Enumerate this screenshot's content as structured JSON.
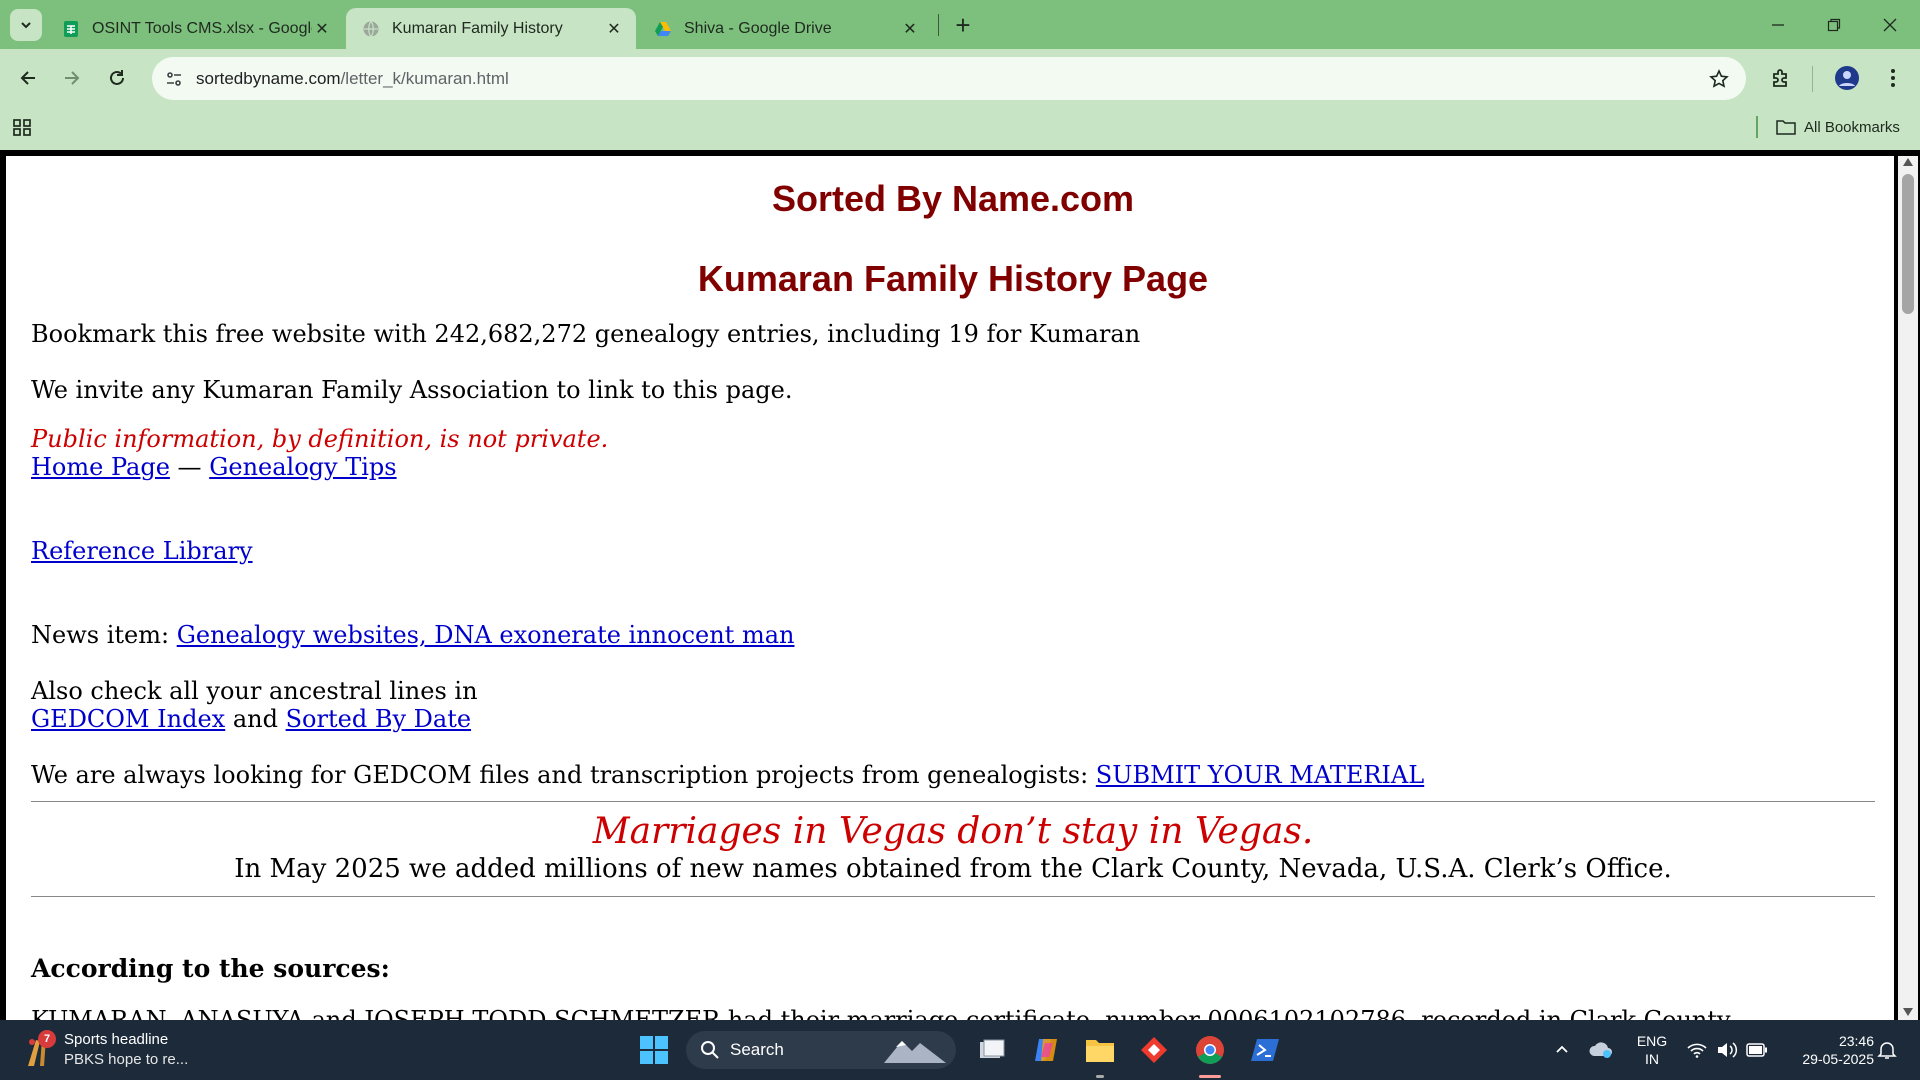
{
  "browser": {
    "tabs": [
      {
        "title": "OSINT Tools CMS.xlsx - Google",
        "favicon": "sheets-icon",
        "active": false
      },
      {
        "title": "Kumaran Family History",
        "favicon": "globe-icon",
        "active": true
      },
      {
        "title": "Shiva - Google Drive",
        "favicon": "drive-icon",
        "active": false
      }
    ],
    "url_host": "sortedbyname.com",
    "url_path": "/letter_k/kumaran.html",
    "all_bookmarks_label": "All Bookmarks",
    "accent_color": "#7dbf7d"
  },
  "page": {
    "site_title": "Sorted By Name.com",
    "page_title": "Kumaran Family History Page",
    "bookmark_line": "Bookmark this free website with 242,682,272 genealogy entries, including 19 for Kumaran",
    "invite_line": "We invite any Kumaran Family Association to link to this page.",
    "public_info": "Public information, by definition, is not private.",
    "home_link": "Home Page",
    "dash": " — ",
    "tips_link": "Genealogy Tips",
    "library_link": "Reference Library",
    "news_prefix": "News item: ",
    "news_link": "Genealogy websites, DNA exonerate innocent man",
    "also_check": "Also check all your ancestral lines in",
    "gedcom_link": "GEDCOM Index",
    "and_text": " and ",
    "sorted_date_link": "Sorted By Date",
    "looking_text": "We are always looking for GEDCOM files and transcription projects from genealogists: ",
    "submit_link": "SUBMIT YOUR MATERIAL",
    "vegas_head": "Marriages in Vegas don’t stay in Vegas.",
    "vegas_sub": "In May 2025 we added millions of new names obtained from the Clark County, Nevada, U.S.A. Clerk’s Office.",
    "sources_head": "According to the sources:",
    "cutoff_line": "KUMARAN, ANASUYA and JOSEPH TODD SCHMETZER had their marriage certificate, number 0006102102786, recorded in Clark County"
  },
  "taskbar": {
    "news_title": "Sports headline",
    "news_sub": "PBKS hope to re...",
    "news_badge": "7",
    "search_label": "Search",
    "lang_top": "ENG",
    "lang_bottom": "IN",
    "time": "23:46",
    "date": "29-05-2025"
  }
}
